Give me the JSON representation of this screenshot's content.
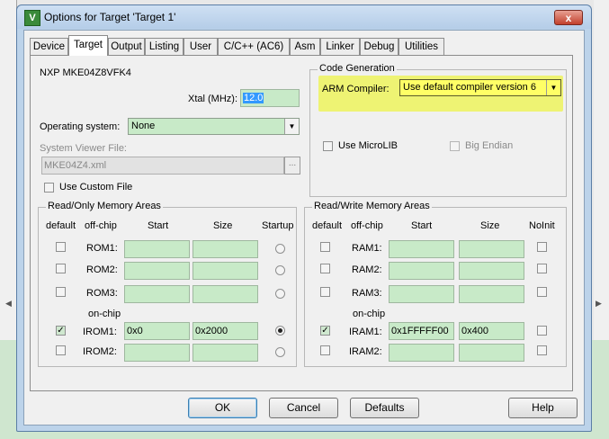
{
  "window": {
    "title": "Options for Target 'Target 1'",
    "icon": "µVision-icon",
    "close": "x"
  },
  "tabs": [
    "Device",
    "Target",
    "Output",
    "Listing",
    "User",
    "C/C++ (AC6)",
    "Asm",
    "Linker",
    "Debug",
    "Utilities"
  ],
  "active_tab": "Target",
  "device_name": "NXP MKE04Z8VFK4",
  "xtal": {
    "label": "Xtal (MHz):",
    "value": "12.0"
  },
  "os": {
    "label": "Operating system:",
    "value": "None"
  },
  "svf": {
    "label": "System Viewer File:",
    "value": "MKE04Z4.xml",
    "browse": "..."
  },
  "use_custom_file": "Use Custom File",
  "code_gen": {
    "title": "Code Generation",
    "compiler_label": "ARM Compiler:",
    "compiler_value": "Use default compiler version 6",
    "microlib": "Use MicroLIB",
    "big_endian": "Big Endian",
    "highlight_color": "#eef373"
  },
  "ro": {
    "title": "Read/Only Memory Areas",
    "headers": {
      "default": "default",
      "offchip": "off-chip",
      "start": "Start",
      "size": "Size",
      "extra": "Startup"
    },
    "onchip": "on-chip",
    "rows": [
      {
        "label": "ROM1:",
        "default": false,
        "start": "",
        "size": "",
        "extra": false
      },
      {
        "label": "ROM2:",
        "default": false,
        "start": "",
        "size": "",
        "extra": false
      },
      {
        "label": "ROM3:",
        "default": false,
        "start": "",
        "size": "",
        "extra": false
      },
      {
        "label": "IROM1:",
        "default": true,
        "start": "0x0",
        "size": "0x2000",
        "extra": true
      },
      {
        "label": "IROM2:",
        "default": false,
        "start": "",
        "size": "",
        "extra": false
      }
    ]
  },
  "rw": {
    "title": "Read/Write Memory Areas",
    "headers": {
      "default": "default",
      "offchip": "off-chip",
      "start": "Start",
      "size": "Size",
      "extra": "NoInit"
    },
    "onchip": "on-chip",
    "rows": [
      {
        "label": "RAM1:",
        "default": false,
        "start": "",
        "size": "",
        "extra": false
      },
      {
        "label": "RAM2:",
        "default": false,
        "start": "",
        "size": "",
        "extra": false
      },
      {
        "label": "RAM3:",
        "default": false,
        "start": "",
        "size": "",
        "extra": false
      },
      {
        "label": "IRAM1:",
        "default": true,
        "start": "0x1FFFFF00",
        "size": "0x400",
        "extra": false
      },
      {
        "label": "IRAM2:",
        "default": false,
        "start": "",
        "size": "",
        "extra": false
      }
    ]
  },
  "buttons": {
    "ok": "OK",
    "cancel": "Cancel",
    "defaults": "Defaults",
    "help": "Help"
  }
}
